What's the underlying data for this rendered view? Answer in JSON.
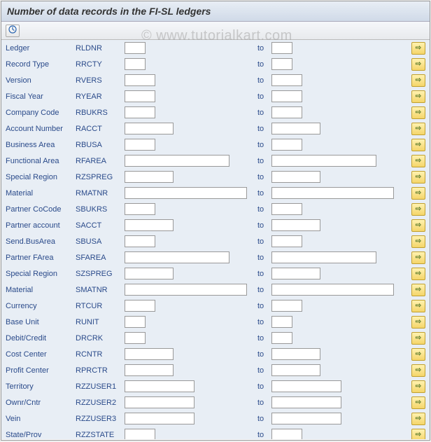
{
  "title": "Number of data records in the FI-SL ledgers",
  "watermark": "© www.tutorialkart.com",
  "to_label": "to",
  "rows": [
    {
      "label": "Ledger",
      "code": "RLDNR",
      "sizeFrom": "sz-xs",
      "sizeTo": "sz-xs"
    },
    {
      "label": "Record Type",
      "code": "RRCTY",
      "sizeFrom": "sz-xs",
      "sizeTo": "sz-xs"
    },
    {
      "label": "Version",
      "code": "RVERS",
      "sizeFrom": "sz-s",
      "sizeTo": "sz-s"
    },
    {
      "label": "Fiscal Year",
      "code": "RYEAR",
      "sizeFrom": "sz-s",
      "sizeTo": "sz-s"
    },
    {
      "label": "Company Code",
      "code": "RBUKRS",
      "sizeFrom": "sz-s",
      "sizeTo": "sz-s"
    },
    {
      "label": "Account Number",
      "code": "RACCT",
      "sizeFrom": "sz-m",
      "sizeTo": "sz-m"
    },
    {
      "label": "Business Area",
      "code": "RBUSA",
      "sizeFrom": "sz-s",
      "sizeTo": "sz-s"
    },
    {
      "label": "Functional Area",
      "code": "RFAREA",
      "sizeFrom": "sz-xl",
      "sizeTo": "sz-xl"
    },
    {
      "label": "Special Region",
      "code": "RZSPREG",
      "sizeFrom": "sz-m",
      "sizeTo": "sz-m"
    },
    {
      "label": "Material",
      "code": "RMATNR",
      "sizeFrom": "sz-xxl",
      "sizeTo": "sz-xxl"
    },
    {
      "label": "Partner CoCode",
      "code": "SBUKRS",
      "sizeFrom": "sz-s",
      "sizeTo": "sz-s"
    },
    {
      "label": "Partner account",
      "code": "SACCT",
      "sizeFrom": "sz-m",
      "sizeTo": "sz-m"
    },
    {
      "label": "Send.BusArea",
      "code": "SBUSA",
      "sizeFrom": "sz-s",
      "sizeTo": "sz-s"
    },
    {
      "label": "Partner FArea",
      "code": "SFAREA",
      "sizeFrom": "sz-xl",
      "sizeTo": "sz-xl"
    },
    {
      "label": "Special Region",
      "code": "SZSPREG",
      "sizeFrom": "sz-m",
      "sizeTo": "sz-m"
    },
    {
      "label": "Material",
      "code": "SMATNR",
      "sizeFrom": "sz-xxl",
      "sizeTo": "sz-xxl"
    },
    {
      "label": "Currency",
      "code": "RTCUR",
      "sizeFrom": "sz-s",
      "sizeTo": "sz-s"
    },
    {
      "label": "Base Unit",
      "code": "RUNIT",
      "sizeFrom": "sz-xs",
      "sizeTo": "sz-xs"
    },
    {
      "label": "Debit/Credit",
      "code": "DRCRK",
      "sizeFrom": "sz-xs",
      "sizeTo": "sz-xs"
    },
    {
      "label": "Cost Center",
      "code": "RCNTR",
      "sizeFrom": "sz-m",
      "sizeTo": "sz-m"
    },
    {
      "label": "Profit Center",
      "code": "RPRCTR",
      "sizeFrom": "sz-m",
      "sizeTo": "sz-m"
    },
    {
      "label": "Territory",
      "code": "RZZUSER1",
      "sizeFrom": "sz-l",
      "sizeTo": "sz-l"
    },
    {
      "label": "Ownr/Cntr",
      "code": "RZZUSER2",
      "sizeFrom": "sz-l",
      "sizeTo": "sz-l"
    },
    {
      "label": "Vein",
      "code": "RZZUSER3",
      "sizeFrom": "sz-l",
      "sizeTo": "sz-l"
    },
    {
      "label": "State/Prov",
      "code": "RZZSTATE",
      "sizeFrom": "sz-s",
      "sizeTo": "sz-s"
    }
  ]
}
